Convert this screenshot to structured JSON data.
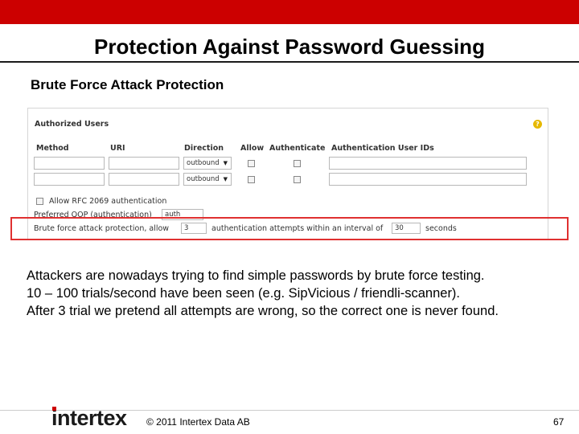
{
  "slide": {
    "title": "Protection Against Password Guessing",
    "subtitle": "Brute Force Attack Protection",
    "accent_color": "#cc0000",
    "body": [
      "Attackers are nowadays trying to find simple passwords by brute force testing.",
      "10 – 100 trials/second have been seen (e.g. SipVicious / friendli-scanner).",
      "After 3 trial we pretend all attempts are wrong, so the correct one is never found."
    ]
  },
  "panel": {
    "title": "Authorized Users",
    "help_icon": "?",
    "columns": [
      "Method",
      "URI",
      "Direction",
      "Allow",
      "Authenticate",
      "Authentication User IDs"
    ],
    "rows": [
      {
        "method": "",
        "uri": "",
        "direction": "outbound",
        "allow": false,
        "authenticate": false,
        "user_ids": ""
      },
      {
        "method": "",
        "uri": "",
        "direction": "outbound",
        "allow": false,
        "authenticate": false,
        "user_ids": ""
      }
    ],
    "rfc2069_label": "Allow RFC 2069 authentication",
    "rfc2069_checked": false,
    "qop_label": "Preferred QOP (authentication)",
    "qop_value": "auth",
    "brute_prefix": "Brute force attack protection, allow",
    "brute_attempts": "3",
    "brute_middle": "authentication attempts within an interval of",
    "brute_interval": "30",
    "brute_suffix": "seconds"
  },
  "footer": {
    "logo_text": "intertex",
    "copyright": "© 2011 Intertex Data AB",
    "page_number": "67"
  }
}
